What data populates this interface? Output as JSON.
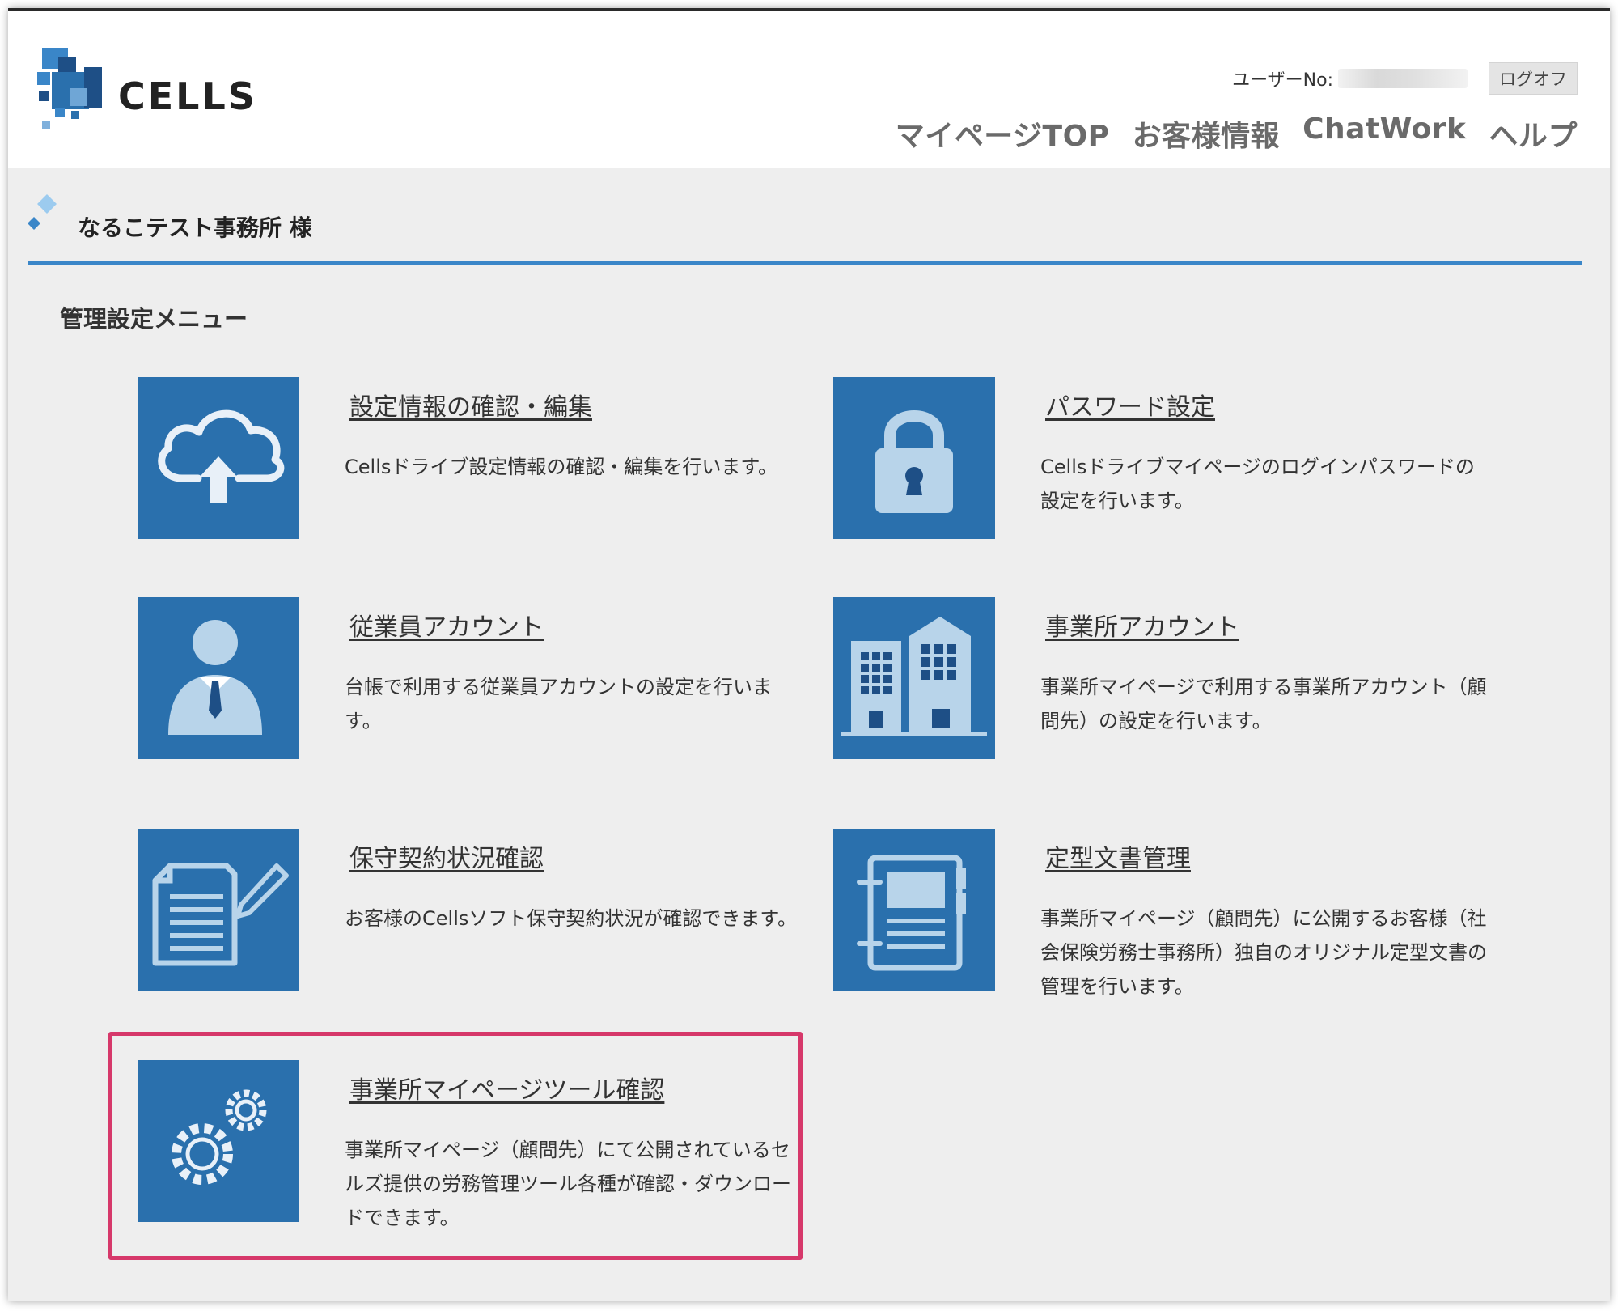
{
  "header": {
    "logo_text": "CELLS",
    "user_label": "ユーザーNo:",
    "logoff_label": "ログオフ",
    "nav": [
      "マイページTOP",
      "お客様情報",
      "ChatWork",
      "ヘルプ"
    ]
  },
  "office": {
    "name": "なるこテスト事務所 様"
  },
  "section_title": "管理設定メニュー",
  "menu": [
    {
      "title": "設定情報の確認・編集",
      "desc": "Cellsドライブ設定情報の確認・編集を行います。",
      "icon": "cloud-upload-icon"
    },
    {
      "title": "パスワード設定",
      "desc": "Cellsドライブマイページのログインパスワードの設定を行います。",
      "icon": "lock-icon"
    },
    {
      "title": "従業員アカウント",
      "desc": "台帳で利用する従業員アカウントの設定を行います。",
      "icon": "employee-icon"
    },
    {
      "title": "事業所アカウント",
      "desc": "事業所マイページで利用する事業所アカウント（顧問先）の設定を行います。",
      "icon": "building-icon"
    },
    {
      "title": "保守契約状況確認",
      "desc": "お客様のCellsソフト保守契約状況が確認できます。",
      "icon": "document-pen-icon"
    },
    {
      "title": "定型文書管理",
      "desc": "事業所マイページ（顧問先）に公開するお客様（社会保険労務士事務所）独自のオリジナル定型文書の管理を行います。",
      "icon": "notebook-icon"
    },
    {
      "title": "事業所マイページツール確認",
      "desc": "事業所マイページ（顧問先）にて公開されているセルズ提供の労務管理ツール各種が確認・ダウンロードできます。",
      "icon": "gears-icon"
    }
  ],
  "colors": {
    "tile": "#2a70ad",
    "accent_line": "#3a86c8",
    "highlight": "#d6386a",
    "icon_fill": "#b8d4ea"
  }
}
